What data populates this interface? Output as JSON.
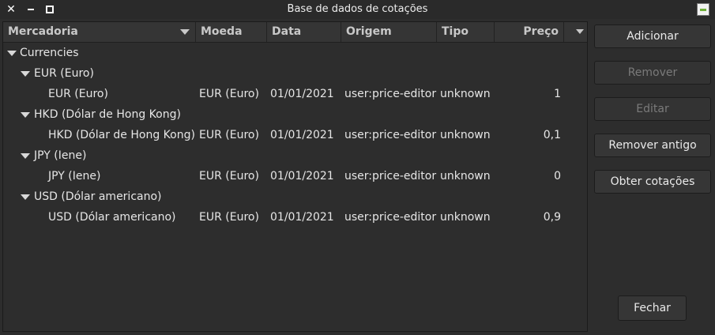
{
  "window": {
    "title": "Base de dados de cotações"
  },
  "columns": {
    "commodity": "Mercadoria",
    "currency": "Moeda",
    "date": "Data",
    "source": "Origem",
    "type": "Tipo",
    "price": "Preço"
  },
  "tree": {
    "root_label": "Currencies",
    "groups": [
      {
        "label": "EUR (Euro)",
        "row": {
          "commodity": "EUR (Euro)",
          "currency": "EUR (Euro)",
          "date": "01/01/2021",
          "source": "user:price-editor",
          "type": "unknown",
          "price": "1"
        }
      },
      {
        "label": "HKD (Dólar de Hong Kong)",
        "row": {
          "commodity": "HKD (Dólar de Hong Kong)",
          "currency": "EUR (Euro)",
          "date": "01/01/2021",
          "source": "user:price-editor",
          "type": "unknown",
          "price": "0,1"
        }
      },
      {
        "label": "JPY (Iene)",
        "row": {
          "commodity": "JPY (Iene)",
          "currency": "EUR (Euro)",
          "date": "01/01/2021",
          "source": "user:price-editor",
          "type": "unknown",
          "price": "0"
        }
      },
      {
        "label": "USD (Dólar americano)",
        "row": {
          "commodity": "USD (Dólar americano)",
          "currency": "EUR (Euro)",
          "date": "01/01/2021",
          "source": "user:price-editor",
          "type": "unknown",
          "price": "0,9"
        }
      }
    ]
  },
  "buttons": {
    "add": "Adicionar",
    "remove": "Remover",
    "edit": "Editar",
    "remove_old": "Remover antigo",
    "get_quotes": "Obter cotações",
    "close": "Fechar"
  }
}
